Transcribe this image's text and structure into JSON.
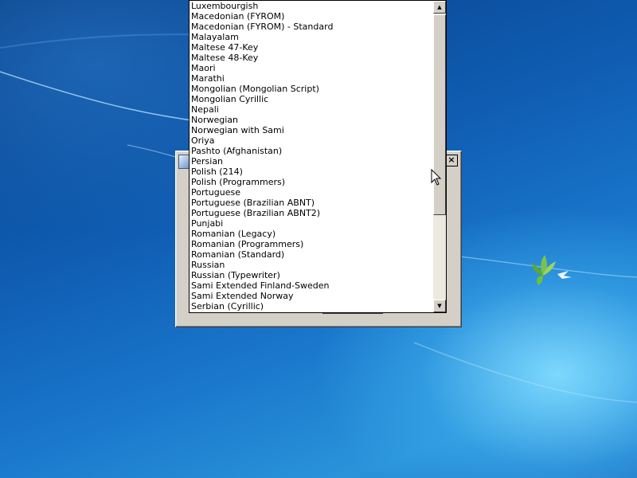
{
  "desktop": {
    "logo_icon": "windows-logo-icon",
    "accent": "#1a78cc"
  },
  "dialog": {
    "icon": "setup-app-icon",
    "close_label": "×"
  },
  "dropdown": {
    "items": [
      "Luxembourgish",
      "Macedonian (FYROM)",
      "Macedonian (FYROM) - Standard",
      "Malayalam",
      "Maltese 47-Key",
      "Maltese 48-Key",
      "Maori",
      "Marathi",
      "Mongolian (Mongolian Script)",
      "Mongolian Cyrillic",
      "Nepali",
      "Norwegian",
      "Norwegian with Sami",
      "Oriya",
      "Pashto (Afghanistan)",
      "Persian",
      "Polish (214)",
      "Polish (Programmers)",
      "Portuguese",
      "Portuguese (Brazilian ABNT)",
      "Portuguese (Brazilian ABNT2)",
      "Punjabi",
      "Romanian (Legacy)",
      "Romanian (Programmers)",
      "Romanian (Standard)",
      "Russian",
      "Russian (Typewriter)",
      "Sami Extended Finland-Sweden",
      "Sami Extended Norway",
      "Serbian (Cyrillic)"
    ],
    "scroll_up_glyph": "▲",
    "scroll_down_glyph": "▼"
  }
}
